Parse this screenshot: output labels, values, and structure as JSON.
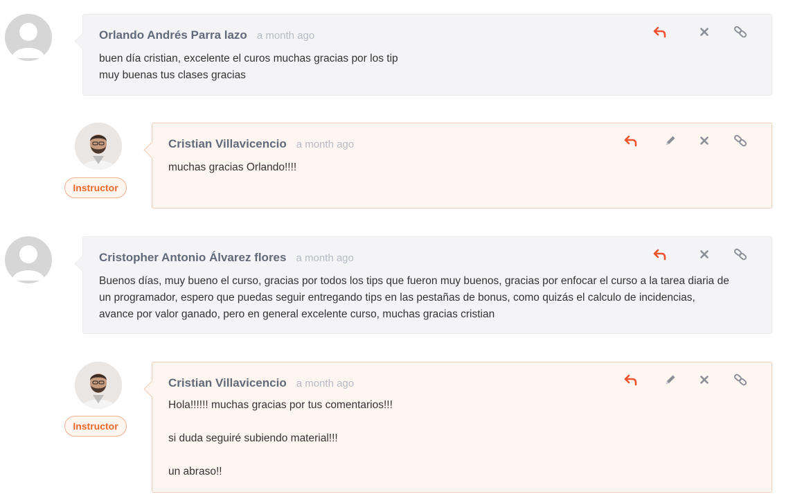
{
  "comments": [
    {
      "author": "Orlando Andrés Parra lazo",
      "time": "a month ago",
      "lines": [
        "buen día cristian, excelente el curos muchas gracias por los tip",
        "muy buenas tus clases gracias"
      ]
    },
    {
      "author": "Cristian Villavicencio",
      "time": "a month ago",
      "badge": "Instructor",
      "lines": [
        "muchas gracias Orlando!!!!"
      ]
    },
    {
      "author": "Cristopher Antonio Álvarez flores",
      "time": "a month ago",
      "lines": [
        "Buenos días, muy bueno el curso, gracias por todos los tips que fueron muy buenos, gracias por enfocar el curso a la tarea diaria de un programador, espero que puedas seguir entregando tips en las pestañas de bonus, como quizás el calculo de incidencias, avance por valor ganado, pero en general excelente curso, muchas gracias cristian"
      ]
    },
    {
      "author": "Cristian Villavicencio",
      "time": "a month ago",
      "badge": "Instructor",
      "lines": [
        "Hola!!!!!! muchas gracias por tus comentarios!!!",
        "si  duda seguiré subiendo material!!!",
        "un abraso!!"
      ]
    }
  ],
  "icons": {
    "reply": "reply-arrow-icon",
    "edit": "pencil-icon",
    "delete": "close-x-icon",
    "link": "chain-link-icon"
  },
  "colors": {
    "reply_icon": "#f0522e",
    "action_icon": "#8b8f98",
    "instructor_badge": "#e9692c",
    "student_bubble": "#f4f4f6",
    "instructor_bubble": "#fff6f1"
  }
}
